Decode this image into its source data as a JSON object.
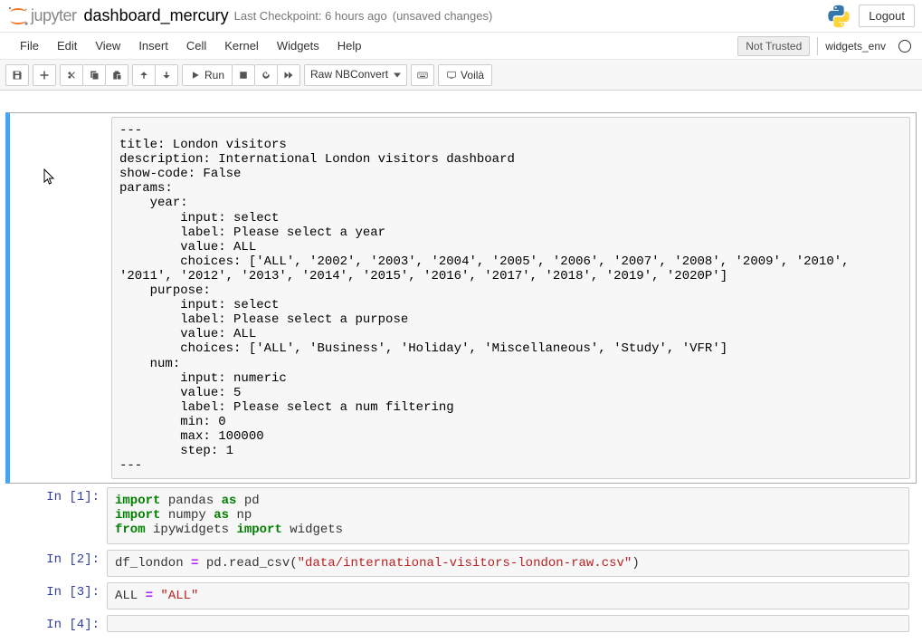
{
  "header": {
    "logo_text": "jupyter",
    "notebook_name": "dashboard_mercury",
    "checkpoint": "Last Checkpoint: 6 hours ago",
    "unsaved": "(unsaved changes)",
    "logout": "Logout"
  },
  "menu": {
    "items": [
      "File",
      "Edit",
      "View",
      "Insert",
      "Cell",
      "Kernel",
      "Widgets",
      "Help"
    ],
    "not_trusted": "Not Trusted",
    "kernel_name": "widgets_env"
  },
  "toolbar": {
    "run_label": "Run",
    "voila_label": "Voilà",
    "cell_type": "Raw NBConvert"
  },
  "cells": [
    {
      "type": "raw",
      "prompt": "",
      "selected": true,
      "content": "---\ntitle: London visitors\ndescription: International London visitors dashboard\nshow-code: False\nparams:\n    year:\n        input: select\n        label: Please select a year\n        value: ALL\n        choices: ['ALL', '2002', '2003', '2004', '2005', '2006', '2007', '2008', '2009', '2010', '2011', '2012', '2013', '2014', '2015', '2016', '2017', '2018', '2019', '2020P']\n    purpose:\n        input: select\n        label: Please select a purpose\n        value: ALL\n        choices: ['ALL', 'Business', 'Holiday', 'Miscellaneous', 'Study', 'VFR']\n    num:\n        input: numeric\n        value: 5\n        label: Please select a num filtering\n        min: 0\n        max: 100000\n        step: 1\n---"
    },
    {
      "type": "code",
      "prompt": "In [1]:",
      "tokens": [
        {
          "c": "kw",
          "t": "import"
        },
        {
          "t": " pandas "
        },
        {
          "c": "kw",
          "t": "as"
        },
        {
          "t": " pd\n"
        },
        {
          "c": "kw",
          "t": "import"
        },
        {
          "t": " numpy "
        },
        {
          "c": "kw",
          "t": "as"
        },
        {
          "t": " np\n"
        },
        {
          "c": "kw",
          "t": "from"
        },
        {
          "t": " ipywidgets "
        },
        {
          "c": "kw",
          "t": "import"
        },
        {
          "t": " widgets"
        }
      ]
    },
    {
      "type": "code",
      "prompt": "In [2]:",
      "tokens": [
        {
          "t": "df_london "
        },
        {
          "c": "op",
          "t": "="
        },
        {
          "t": " pd.read_csv("
        },
        {
          "c": "str",
          "t": "\"data/international-visitors-london-raw.csv\""
        },
        {
          "t": ")"
        }
      ]
    },
    {
      "type": "code",
      "prompt": "In [3]:",
      "tokens": [
        {
          "t": "ALL "
        },
        {
          "c": "op",
          "t": "="
        },
        {
          "t": " "
        },
        {
          "c": "str",
          "t": "\"ALL\""
        }
      ]
    },
    {
      "type": "code",
      "prompt": "In [4]:",
      "tokens": []
    }
  ]
}
